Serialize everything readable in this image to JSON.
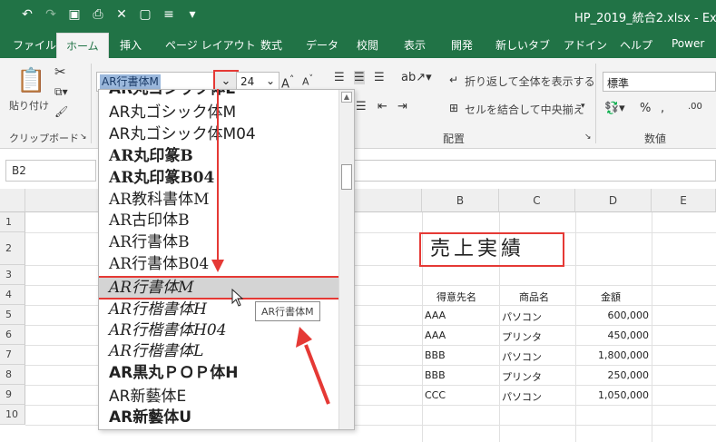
{
  "window": {
    "title": "HP_2019_統合2.xlsx - Ex"
  },
  "qat": {
    "undo_icon": "undo-icon",
    "redo_icon": "redo-icon",
    "save_icon": "save-icon",
    "print_preview_icon": "print-preview-icon",
    "close_icon": "close-icon",
    "new_icon": "new-file-icon",
    "custom_icon": "custom-icon",
    "more_icon": "more-icon"
  },
  "tabs": [
    "ファイル",
    "ホーム",
    "挿入",
    "ページ レイアウト",
    "数式",
    "データ",
    "校閲",
    "表示",
    "開発",
    "新しいタブ",
    "アドイン",
    "ヘルプ",
    "Power"
  ],
  "ribbon": {
    "paste_label": "貼り付け",
    "clipboard_group": "クリップボード",
    "font_name": "AR行書体M",
    "font_size": "24",
    "wrap_text": "折り返して全体を表示する",
    "merge_center": "セルを結合して中央揃え",
    "alignment_group": "配置",
    "number_format": "標準",
    "number_group": "数値"
  },
  "namebox": "B2",
  "font_list": [
    {
      "name": "AR丸ゴシック体L",
      "style": "b"
    },
    {
      "name": "AR丸ゴシック体M",
      "style": "n"
    },
    {
      "name": "AR丸ゴシック体M04",
      "style": "n"
    },
    {
      "name": "AR丸印篆B",
      "style": "s"
    },
    {
      "name": "AR丸印篆B04",
      "style": "s"
    },
    {
      "name": "AR教科書体M",
      "style": "s"
    },
    {
      "name": "AR古印体B",
      "style": "s"
    },
    {
      "name": "AR行書体B",
      "style": "s"
    },
    {
      "name": "AR行書体B04",
      "style": "s"
    },
    {
      "name": "AR行書体M",
      "style": "i"
    },
    {
      "name": "AR行楷書体H",
      "style": "i"
    },
    {
      "name": "AR行楷書体H04",
      "style": "i"
    },
    {
      "name": "AR行楷書体L",
      "style": "i"
    },
    {
      "name": "AR黒丸ＰＯＰ体H",
      "style": "b"
    },
    {
      "name": "AR新藝体E",
      "style": "n"
    },
    {
      "name": "AR新藝体U",
      "style": "b"
    }
  ],
  "tooltip": "AR行書体M",
  "columns": [
    "B",
    "C",
    "D",
    "E"
  ],
  "rows": [
    "1",
    "2",
    "3",
    "4",
    "5",
    "6",
    "7",
    "8",
    "9",
    "10"
  ],
  "sheet": {
    "title": "売上実績",
    "headers": [
      "得意先名",
      "商品名",
      "金額"
    ],
    "data": [
      [
        "AAA",
        "パソコン",
        "600,000"
      ],
      [
        "AAA",
        "プリンタ",
        "450,000"
      ],
      [
        "BBB",
        "パソコン",
        "1,800,000"
      ],
      [
        "BBB",
        "プリンタ",
        "250,000"
      ],
      [
        "CCC",
        "パソコン",
        "1,050,000"
      ]
    ]
  },
  "colors": {
    "excel_green": "#217346",
    "highlight_red": "#e53935"
  }
}
